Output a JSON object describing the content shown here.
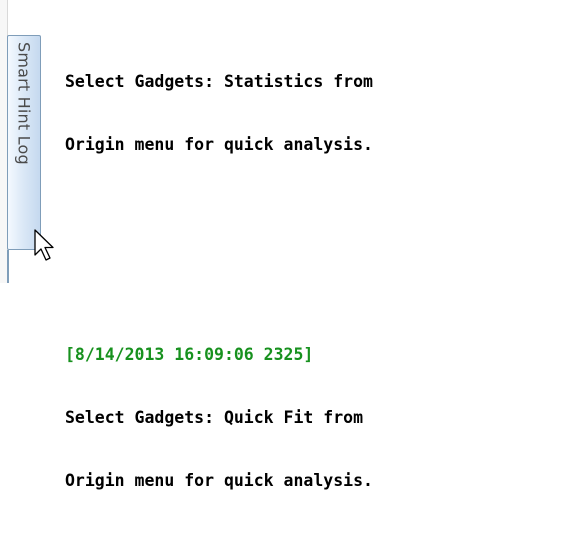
{
  "hint_panel": {
    "tab_label": "Smart Hint Log"
  },
  "log": {
    "entries": [
      {
        "lines": [
          "Select Gadgets: Statistics from",
          "Origin menu for quick analysis."
        ]
      },
      {
        "timestamp": "[8/14/2013 16:09:06 2325]",
        "lines": [
          "Select Gadgets: Quick Fit from",
          "Origin menu for quick analysis."
        ]
      }
    ]
  },
  "colors": {
    "timestamp": "#17911e",
    "text": "#000000",
    "tab_border": "#7f9db9"
  }
}
